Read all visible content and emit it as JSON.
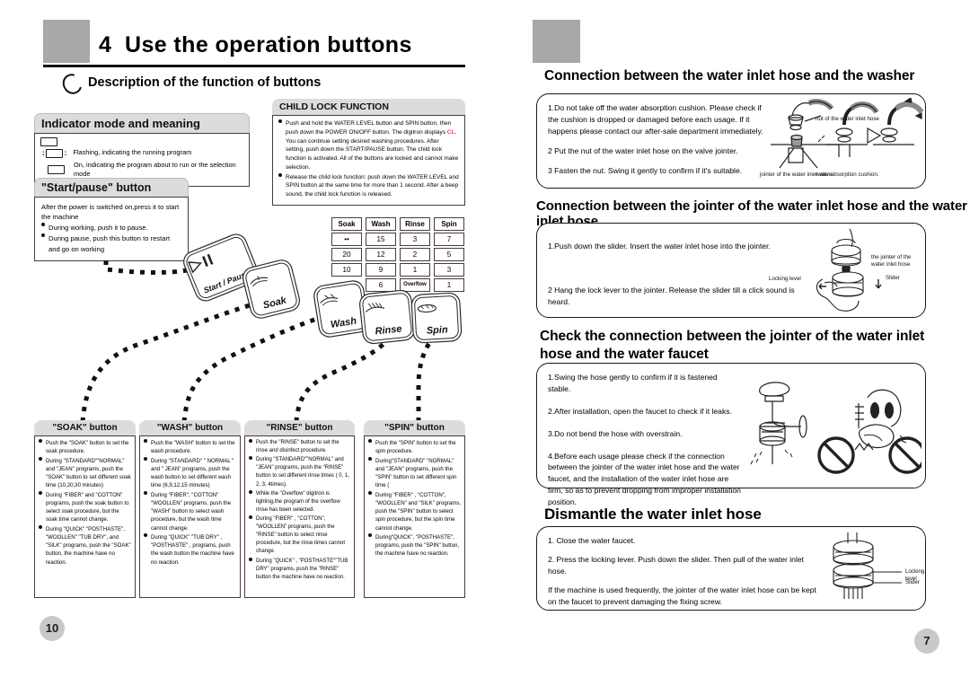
{
  "document": {
    "left_page": {
      "chapter_number": "4",
      "chapter_title": "Use the  operation buttons",
      "subhead": "Description of the function of  buttons",
      "page_number": "10",
      "indicator_panel": {
        "title": "Indicator mode and meaning",
        "rows": [
          {
            "lamp": "lamp-outline",
            "text": ""
          },
          {
            "lamp": "lamp-flashing",
            "text": "Flashing, indicating the running program"
          },
          {
            "lamp": "lamp-on",
            "text": "On, indicating the program about to run or the selection mode"
          }
        ]
      },
      "startpause_panel": {
        "title": "\"Start/pause\" button",
        "intro": "After the power is switched on,press it to start the machine",
        "items": [
          "During working, push it to pause.",
          "During pause, push this button to restart and go on working"
        ]
      },
      "childlock_panel": {
        "title": "CHILD LOCK FUNCTION",
        "item1_a": "Push and hold the  WATER LEVEL  button and  SPIN button, then push down the  POWER ON/OFF  button. The digitron displays ",
        "item1_code": "CL",
        "item1_b": ". You can continue setting desired washing procedures. After setting, push down the START/PAUSE  button. The child lock function is activated. All of the buttons are locked and cannot make selection.",
        "item2": "Release the child lock function: push down the  WATER LEVEL and SPIN  button at the same time for more than 1 second. After a beep sound, the child lock function is released."
      },
      "control_table": {
        "headers": [
          "Soak",
          "Wash",
          "Rinse",
          "Spin"
        ],
        "rows": [
          [
            "••",
            "15",
            "3",
            "7"
          ],
          [
            "20",
            "12",
            "2",
            "5"
          ],
          [
            "10",
            "9",
            "1",
            "3"
          ],
          [
            "",
            "6",
            "Overflow",
            "1"
          ]
        ]
      },
      "keys": [
        {
          "name": "start-pause",
          "label": "Start / Pause",
          "icon": "▷||"
        },
        {
          "name": "soak",
          "label": "Soak",
          "icon": "soak-icon"
        },
        {
          "name": "wash",
          "label": "Wash",
          "icon": "wash-icon"
        },
        {
          "name": "rinse",
          "label": "Rinse",
          "icon": "rinse-icon"
        },
        {
          "name": "spin",
          "label": "Spin",
          "icon": "spin-icon"
        }
      ],
      "button_boxes": [
        {
          "title": "\"SOAK\" button",
          "items": [
            "Push the  \"SOAK\"  button to set the soak procedure.",
            "During \"STANDARD\"\"NORMAL\" and \"JEAN\" programs, push the \"SOAK\" button to set different soak time (10,20,30 minutes)",
            "During \"FIBER\" and \"COTTON\"  programs, push the soak button to select soak procedure, but the soak time cannot change.",
            "During \"QUICK\" \"POSTHASTE\", \"WOOLLEN\" \"TUB DRY\", and \"SILK\"  programs, push the \"SOAK\"  button, the machine have no reaction."
          ]
        },
        {
          "title": "\"WASH\" button",
          "items": [
            "Push the \"WASH\" button to set the wash procedure.",
            "During \"STANDARD\" \" NORMAL \" and \" JEAN\" programs, push  the  wash button to set different wash time (6,9,12,15 minutes)",
            "During \"FIBER\", \"COTTON\" \"WOOLLEN\"  programs, push the  \"WASH\" button to select wash  procedure, but the wash time cannot change.",
            "During \"QUICK\" \"TUB DRY\" , \"POSTHASTE\" , programs, push  the  wash  button the machine have no reaction."
          ]
        },
        {
          "title": "\"RINSE\" button",
          "items": [
            "Push the  \"RINSE\"  button to set the rinse and disinfect procedure.",
            "During \"STANDARD\"\"NORMAL\" and \"JEAN\" programs, push the \"RINSE\" button  to  set  different  rinse  times ( 0, 1, 2, 3, 4times).",
            "While the \"Overflow\" digitron is lighting,the program of the overflow rinse has been selected.",
            "During  \"FIBER\" , \"COTTON\", \"WOOLLEN\"  programs, push the \"RINSE\" button to select  rinse  procedure, but the rinse times cannot change.",
            "During \"QUICK\" , \"POSTHASTE\"\"TUB DRY\" programs, push the \"RINSE\" button the machine have no reaction."
          ]
        },
        {
          "title": "\"SPIN\" button",
          "items": [
            "Push the \"SPIN\" button to set the spin procedure.",
            "During\"STANDARD\" \"NORMAL\" and \"JEAN\" programs, push the  \"SPIN\" button to set different spin time (",
            "During \"FIBER\" , \"COTTON\", \"WOOLLEN\" and \"SILK\" programs, push the \"SPIN\" button to select spin  procedure, but the spin time cannot change.",
            "During\"QUICK\", \"POSTHASTE\", programs, push the \"SPIN\" button, the machine have no reaction."
          ]
        }
      ]
    },
    "right_page": {
      "page_number": "7",
      "sections": [
        {
          "title": "Connection between the water inlet hose and the washer",
          "paragraphs": [
            "1.Do not take off the water absorption cushion. Please check if the cushion is dropped or damaged before each usage. If it happens please contact our after-sale department immediately.",
            "2 Put the nut of the water inlet hose on the valve jointer.",
            "3 Fasten the nut. Swing it gently to confirm if it's suitable."
          ],
          "labels": [
            "nut of the water inlet hose",
            "jointer of the water inlet valve",
            "water absorption cushion."
          ]
        },
        {
          "title": "Connection between the jointer of the water inlet hose and the water inlet hose",
          "paragraphs": [
            "1.Push down the slider. Insert the water inlet hose into the jointer.",
            "2 Hang the lock lever to the jointer. Release the slider till a click sound is heard."
          ],
          "labels": [
            "the jointer of the water inlet hose",
            "Locking level",
            "Slider"
          ]
        },
        {
          "title": "Check the connection between the jointer of the water inlet hose and the water faucet",
          "paragraphs": [
            "1.Swing the hose gently to confirm if it is fastened stable.",
            "2.After installation, open the faucet to check if it leaks.",
            "3.Do not bend the hose with overstrain.",
            "4.Before each usage please check if the connection between the jointer of the water inlet hose and the water faucet, and the installation of the water inlet hose are firm, so as to prevent dropping from improper installation position."
          ],
          "labels": []
        },
        {
          "title": "Dismantle the water inlet hose",
          "paragraphs": [
            "1. Close the water faucet.",
            "2. Press the locking lever. Push down the slider. Then pull of the water inlet hose.",
            "If the machine is used frequently, the jointer of the water inlet hose can be kept on the faucet to prevent damaging the fixing screw."
          ],
          "labels": [
            "Locking level",
            "Slider"
          ]
        }
      ]
    },
    "colors": {
      "accent_gray": "#a8a8a8",
      "band_gray": "#dcdcdc",
      "pagenum_gray": "#c9c9c9",
      "highlight_pink": "#e8357f",
      "border": "#4a3b3b"
    }
  }
}
